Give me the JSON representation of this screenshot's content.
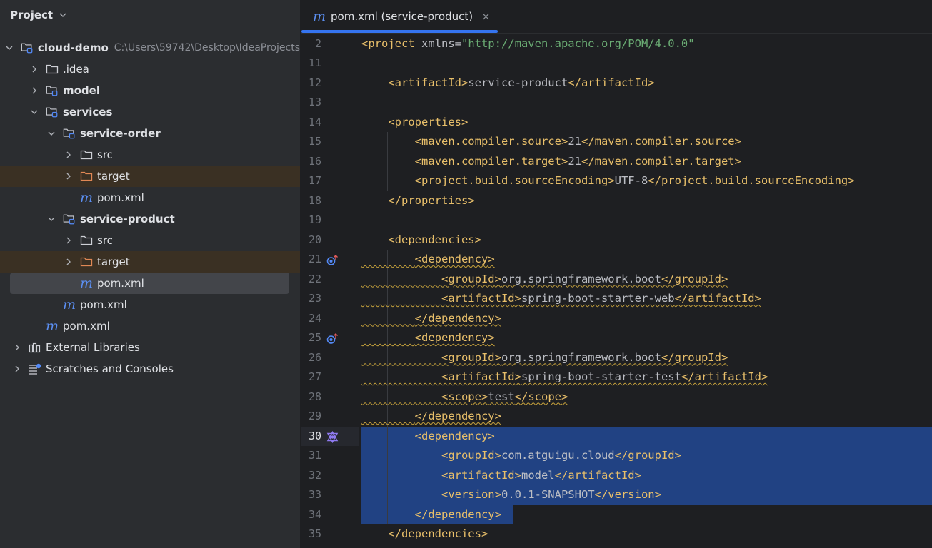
{
  "panel": {
    "title": "Project"
  },
  "tree": [
    {
      "label": "cloud-demo",
      "path": "C:\\Users\\59742\\Desktop\\IdeaProjects",
      "bold": true,
      "icon": "module-folder-icon",
      "state": "expanded"
    },
    {
      "label": ".idea",
      "icon": "folder-icon",
      "state": "collapsed"
    },
    {
      "label": "model",
      "bold": true,
      "icon": "module-folder-icon",
      "state": "collapsed"
    },
    {
      "label": "services",
      "bold": true,
      "icon": "module-folder-icon",
      "state": "expanded"
    },
    {
      "label": "service-order",
      "bold": true,
      "icon": "module-folder-icon",
      "state": "expanded"
    },
    {
      "label": "src",
      "icon": "folder-icon",
      "state": "collapsed"
    },
    {
      "label": "target",
      "icon": "excluded-folder-icon",
      "state": "collapsed"
    },
    {
      "label": "pom.xml",
      "icon": "maven-icon",
      "state": "none"
    },
    {
      "label": "service-product",
      "bold": true,
      "icon": "module-folder-icon",
      "state": "expanded"
    },
    {
      "label": "src",
      "icon": "folder-icon",
      "state": "collapsed"
    },
    {
      "label": "target",
      "icon": "excluded-folder-icon",
      "state": "collapsed"
    },
    {
      "label": "pom.xml",
      "icon": "maven-icon",
      "state": "none",
      "selected": true
    },
    {
      "label": "pom.xml",
      "icon": "maven-icon",
      "state": "none"
    },
    {
      "label": "pom.xml",
      "icon": "maven-icon",
      "state": "none"
    },
    {
      "label": "External Libraries",
      "icon": "library-icon",
      "state": "collapsed"
    },
    {
      "label": "Scratches and Consoles",
      "icon": "scratches-icon",
      "state": "collapsed"
    }
  ],
  "editor": {
    "tab_title": "pom.xml (service-product)",
    "tab_close": "×",
    "current_line": 30,
    "lines": [
      {
        "n": 2,
        "text": "<project xmlns=\"http://maven.apache.org/POM/4.0.0\""
      },
      {
        "n": 11,
        "text": ""
      },
      {
        "n": 12,
        "text": "    <artifactId>service-product</artifactId>"
      },
      {
        "n": 13,
        "text": ""
      },
      {
        "n": 14,
        "text": "    <properties>"
      },
      {
        "n": 15,
        "text": "        <maven.compiler.source>21</maven.compiler.source>"
      },
      {
        "n": 16,
        "text": "        <maven.compiler.target>21</maven.compiler.target>"
      },
      {
        "n": 17,
        "text": "        <project.build.sourceEncoding>UTF-8</project.build.sourceEncoding>"
      },
      {
        "n": 18,
        "text": "    </properties>"
      },
      {
        "n": 19,
        "text": ""
      },
      {
        "n": 20,
        "text": "    <dependencies>"
      },
      {
        "n": 21,
        "text": "        <dependency>",
        "warn": true,
        "gutter_icon": "override-icon"
      },
      {
        "n": 22,
        "text": "            <groupId>org.springframework.boot</groupId>",
        "warn": true
      },
      {
        "n": 23,
        "text": "            <artifactId>spring-boot-starter-web</artifactId>",
        "warn": true
      },
      {
        "n": 24,
        "text": "        </dependency>",
        "warn": true
      },
      {
        "n": 25,
        "text": "        <dependency>",
        "warn": true,
        "gutter_icon": "override-icon"
      },
      {
        "n": 26,
        "text": "            <groupId>org.springframework.boot</groupId>",
        "warn": true
      },
      {
        "n": 27,
        "text": "            <artifactId>spring-boot-starter-test</artifactId>",
        "warn": true
      },
      {
        "n": 28,
        "text": "            <scope>test</scope>",
        "warn": true
      },
      {
        "n": 29,
        "text": "        </dependency>",
        "warn": true
      },
      {
        "n": 30,
        "text": "        <dependency>",
        "selected": true,
        "gutter_icon": "maven-sync-icon"
      },
      {
        "n": 31,
        "text": "            <groupId>com.atguigu.cloud</groupId>",
        "selected": true
      },
      {
        "n": 32,
        "text": "            <artifactId>model</artifactId>",
        "selected": true
      },
      {
        "n": 33,
        "text": "            <version>0.0.1-SNAPSHOT</version>",
        "selected": true
      },
      {
        "n": 34,
        "text": "        </dependency>",
        "selected": true
      },
      {
        "n": 35,
        "text": "    </dependencies>"
      }
    ]
  },
  "colors": {
    "tag": "#e8bf6a",
    "string": "#6aab73",
    "text": "#bcbec4",
    "selection": "#214283",
    "accent": "#3574f0",
    "excluded_bg": "#3a3023"
  }
}
